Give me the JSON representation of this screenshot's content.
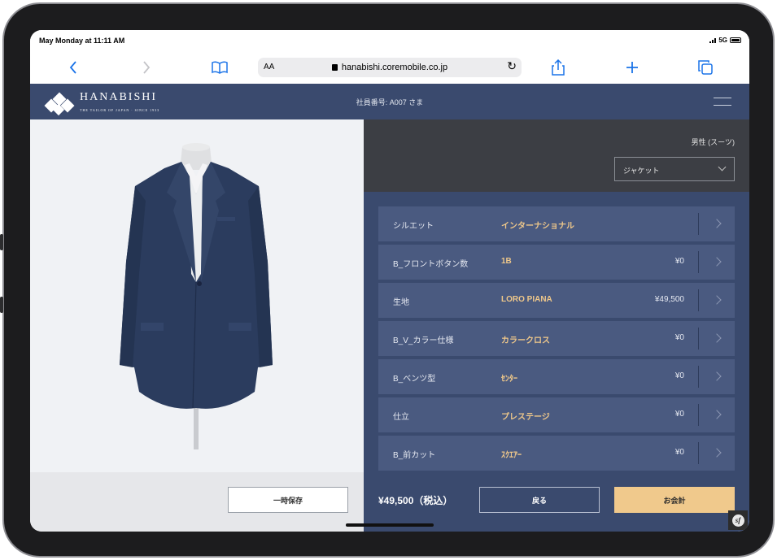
{
  "status_bar": {
    "time": "May Monday at 11:11 AM",
    "network": "5G"
  },
  "browser": {
    "aa_label": "AA",
    "url": "hanabishi.coremobile.co.jp",
    "icons": [
      "back-icon",
      "forward-icon",
      "bookmarks-icon",
      "lock-icon",
      "reload-icon",
      "share-icon",
      "new-tab-icon",
      "tabs-icon"
    ]
  },
  "header": {
    "brand": "HANABISHI",
    "tagline": "THE TAILOR OF JAPAN · SINCE 1933",
    "employee": "社員番号: A007 さま"
  },
  "config": {
    "gender": "男性 (スーツ)",
    "item_select": "ジャケット"
  },
  "options": [
    {
      "label": "シルエット",
      "value": "インターナショナル",
      "price": ""
    },
    {
      "label": "B_フロントボタン数",
      "value": "1B",
      "price": "¥0"
    },
    {
      "label": "生地",
      "value": "LORO PIANA",
      "price": "¥49,500"
    },
    {
      "label": "B_V_カラー仕様",
      "value": "カラークロス",
      "price": "¥0"
    },
    {
      "label": "B_ベンツ型",
      "value": "ｾﾝﾀｰ",
      "price": "¥0"
    },
    {
      "label": "仕立",
      "value": "プレステージ",
      "price": "¥0"
    },
    {
      "label": "B_前カット",
      "value": "ｽｸｴｱｰ",
      "price": "¥0"
    }
  ],
  "footer": {
    "save_label": "一時保存",
    "total": "¥49,500（税込）",
    "back_label": "戻る",
    "checkout_label": "お会計"
  },
  "colors": {
    "navy": "#3a4a6e",
    "row": "#4a5a80",
    "gold": "#eec78a",
    "checkout": "#f0c98c",
    "dark_panel": "#3c3e44"
  }
}
